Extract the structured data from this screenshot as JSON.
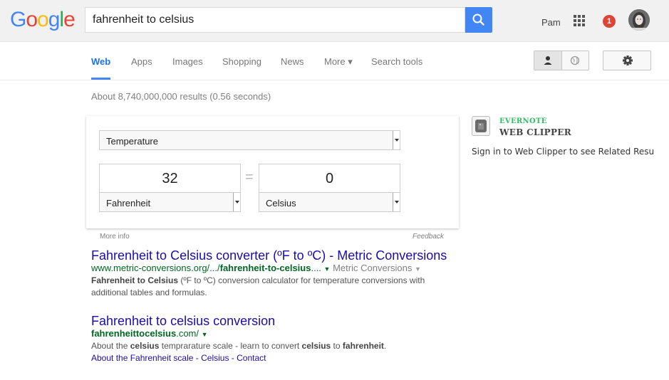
{
  "logo": {
    "letters": [
      "G",
      "o",
      "o",
      "g",
      "l",
      "e"
    ]
  },
  "search": {
    "query": "fahrenheit to celsius"
  },
  "account": {
    "user_name": "Pam",
    "notification_count": "1"
  },
  "nav": {
    "tabs": [
      {
        "label": "Web",
        "active": true
      },
      {
        "label": "Apps"
      },
      {
        "label": "Images"
      },
      {
        "label": "Shopping"
      },
      {
        "label": "News"
      },
      {
        "label": "More ▾"
      },
      {
        "label": "Search tools"
      }
    ]
  },
  "result_stats": "About 8,740,000,000 results (0.56 seconds)",
  "converter": {
    "quantity": "Temperature",
    "from_value": "32",
    "equals": "=",
    "to_value": "0",
    "from_unit": "Fahrenheit",
    "to_unit": "Celsius",
    "more_info": "More info",
    "feedback": "Feedback"
  },
  "results": [
    {
      "title": "Fahrenheit to Celsius converter (ºF to ºC) - Metric Conversions",
      "url_prefix": "www.metric-conversions.org/.../",
      "url_bold": "fahrenheit-to-celsius",
      "url_suffix": "....",
      "breadcrumb": "Metric Conversions",
      "snippet_bold": "Fahrenheit to Celsius",
      "snippet_1": " (ºF to ºC) conversion calculator for temperature conversions with additional tables and formulas."
    },
    {
      "title": "Fahrenheit to celsius conversion",
      "url_bold": "fahrenheittocelsius",
      "url_suffix": ".com/",
      "snippet_a": "About the ",
      "snippet_b": "celsius",
      "snippet_c": " temprarature scale - learn to convert ",
      "snippet_d": "celsius",
      "snippet_e": " to ",
      "snippet_f": "fahrenheit",
      "snippet_g": ".",
      "sitelinks": [
        "About the Fahrenheit scale",
        "Celsius",
        "Contact"
      ],
      "sitelink_sep": " - "
    }
  ],
  "evernote": {
    "brand": "EVERNOTE",
    "product": "WEB CLIPPER",
    "signin": "Sign in to Web Clipper to see Related Resu"
  },
  "colors": {
    "accent": "#4285f4",
    "link": "#1a0dab",
    "url_green": "#006621",
    "evernote_green": "#2dbe60",
    "notif_red": "#db4437"
  }
}
